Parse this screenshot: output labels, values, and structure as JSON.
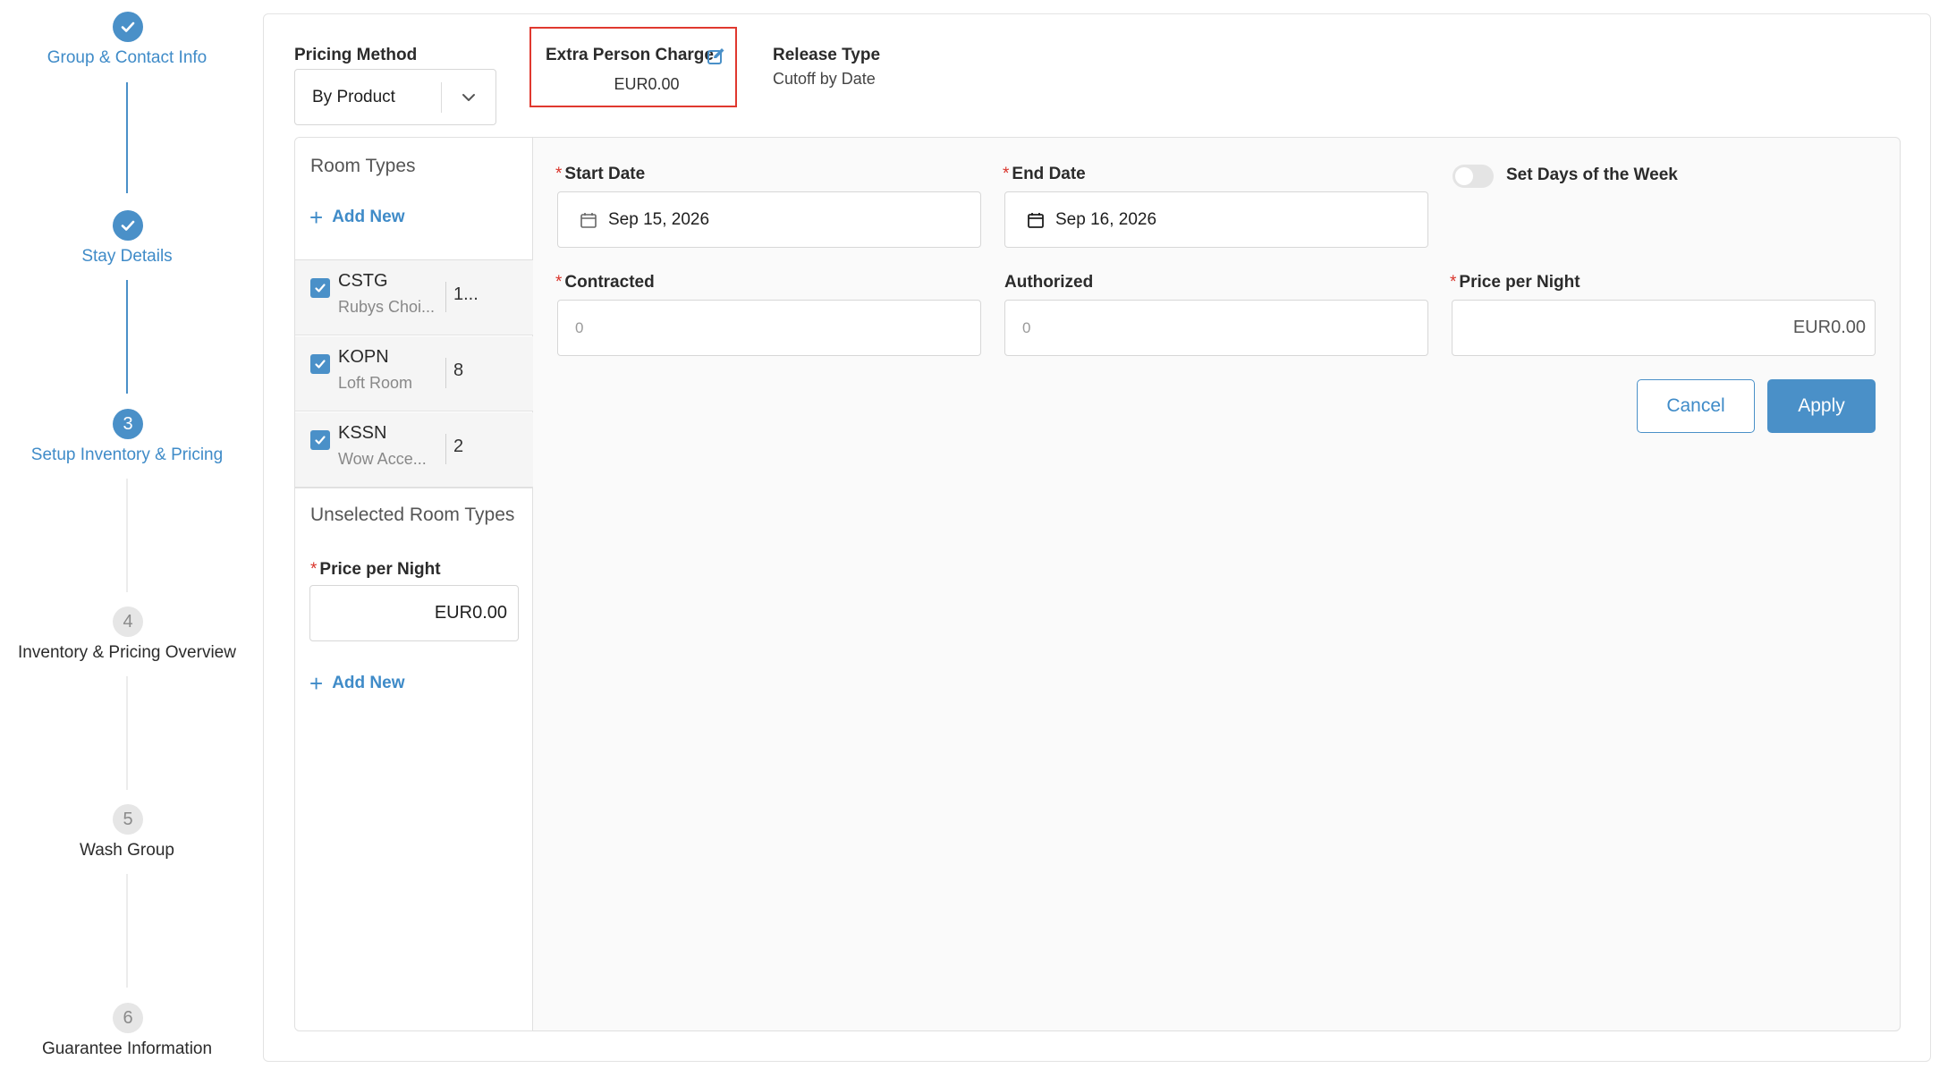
{
  "stepper": {
    "steps": [
      {
        "number": "",
        "label": "Group & Contact Info",
        "state": "done"
      },
      {
        "number": "",
        "label": "Stay Details",
        "state": "done"
      },
      {
        "number": "3",
        "label": "Setup Inventory & Pricing",
        "state": "active"
      },
      {
        "number": "4",
        "label": "Inventory & Pricing Overview",
        "state": "todo"
      },
      {
        "number": "5",
        "label": "Wash Group",
        "state": "todo"
      },
      {
        "number": "6",
        "label": "Guarantee Information",
        "state": "todo"
      }
    ]
  },
  "header": {
    "pricing_method_label": "Pricing Method",
    "pricing_method_value": "By Product",
    "extra_person_charge_label": "Extra Person Charge",
    "extra_person_charge_value": "EUR0.00",
    "release_type_label": "Release Type",
    "release_type_value": "Cutoff by Date"
  },
  "room_types": {
    "title": "Room Types",
    "add_new_label": "Add New",
    "items": [
      {
        "code": "CSTG",
        "name": "Rubys Choi...",
        "count": "1...",
        "checked": true
      },
      {
        "code": "KOPN",
        "name": "Loft Room",
        "count": "8",
        "checked": true
      },
      {
        "code": "KSSN",
        "name": "Wow Acce...",
        "count": "2",
        "checked": true
      }
    ]
  },
  "unselected": {
    "title": "Unselected Room Types",
    "price_label": "Price per Night",
    "price_value": "EUR0.00",
    "add_new_label": "Add New"
  },
  "form": {
    "start_date_label": "Start Date",
    "start_date_value": "Sep 15, 2026",
    "end_date_label": "End Date",
    "end_date_value": "Sep 16, 2026",
    "set_days_label": "Set Days of the Week",
    "set_days_enabled": false,
    "contracted_label": "Contracted",
    "contracted_placeholder": "0",
    "authorized_label": "Authorized",
    "authorized_placeholder": "0",
    "price_label": "Price per Night",
    "price_value": "EUR0.00",
    "cancel_label": "Cancel",
    "apply_label": "Apply"
  },
  "colors": {
    "accent": "#4a90c8",
    "highlight_border": "#e0392f",
    "required": "#d9342b"
  }
}
